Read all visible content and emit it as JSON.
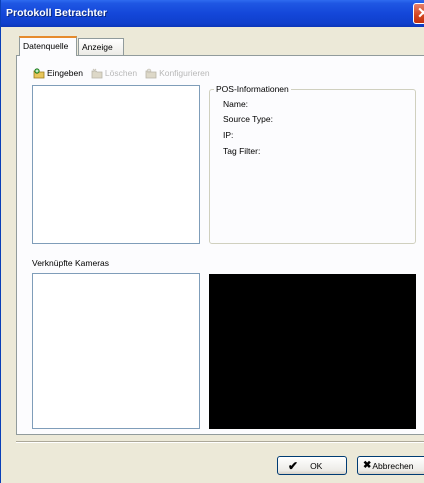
{
  "window": {
    "title": "Protokoll Betrachter",
    "close_glyph": "✕"
  },
  "tabs": [
    {
      "label": "Datenquelle",
      "active": true
    },
    {
      "label": "Anzeige",
      "active": false
    }
  ],
  "toolbar": {
    "items": [
      {
        "label": "Eingeben",
        "enabled": true,
        "icon": "add-folder-icon"
      },
      {
        "label": "Löschen",
        "enabled": false,
        "icon": "delete-folder-icon"
      },
      {
        "label": "Konfigurieren",
        "enabled": false,
        "icon": "configure-folder-icon"
      }
    ]
  },
  "pos_info": {
    "title": "POS-Informationen",
    "name_label": "Name:",
    "source_type_label": "Source Type:",
    "ip_label": "IP:",
    "tag_filter_label": "Tag Filter:"
  },
  "cameras": {
    "label": "Verknüpfte Kameras"
  },
  "buttons": {
    "ok_label": "OK",
    "ok_glyph": "✔",
    "cancel_label": "Abbrechen",
    "cancel_glyph": "✖"
  },
  "colors": {
    "title_bar": "#1447d9",
    "active_tab_accent": "#e68b2c",
    "video_background": "#000000"
  }
}
